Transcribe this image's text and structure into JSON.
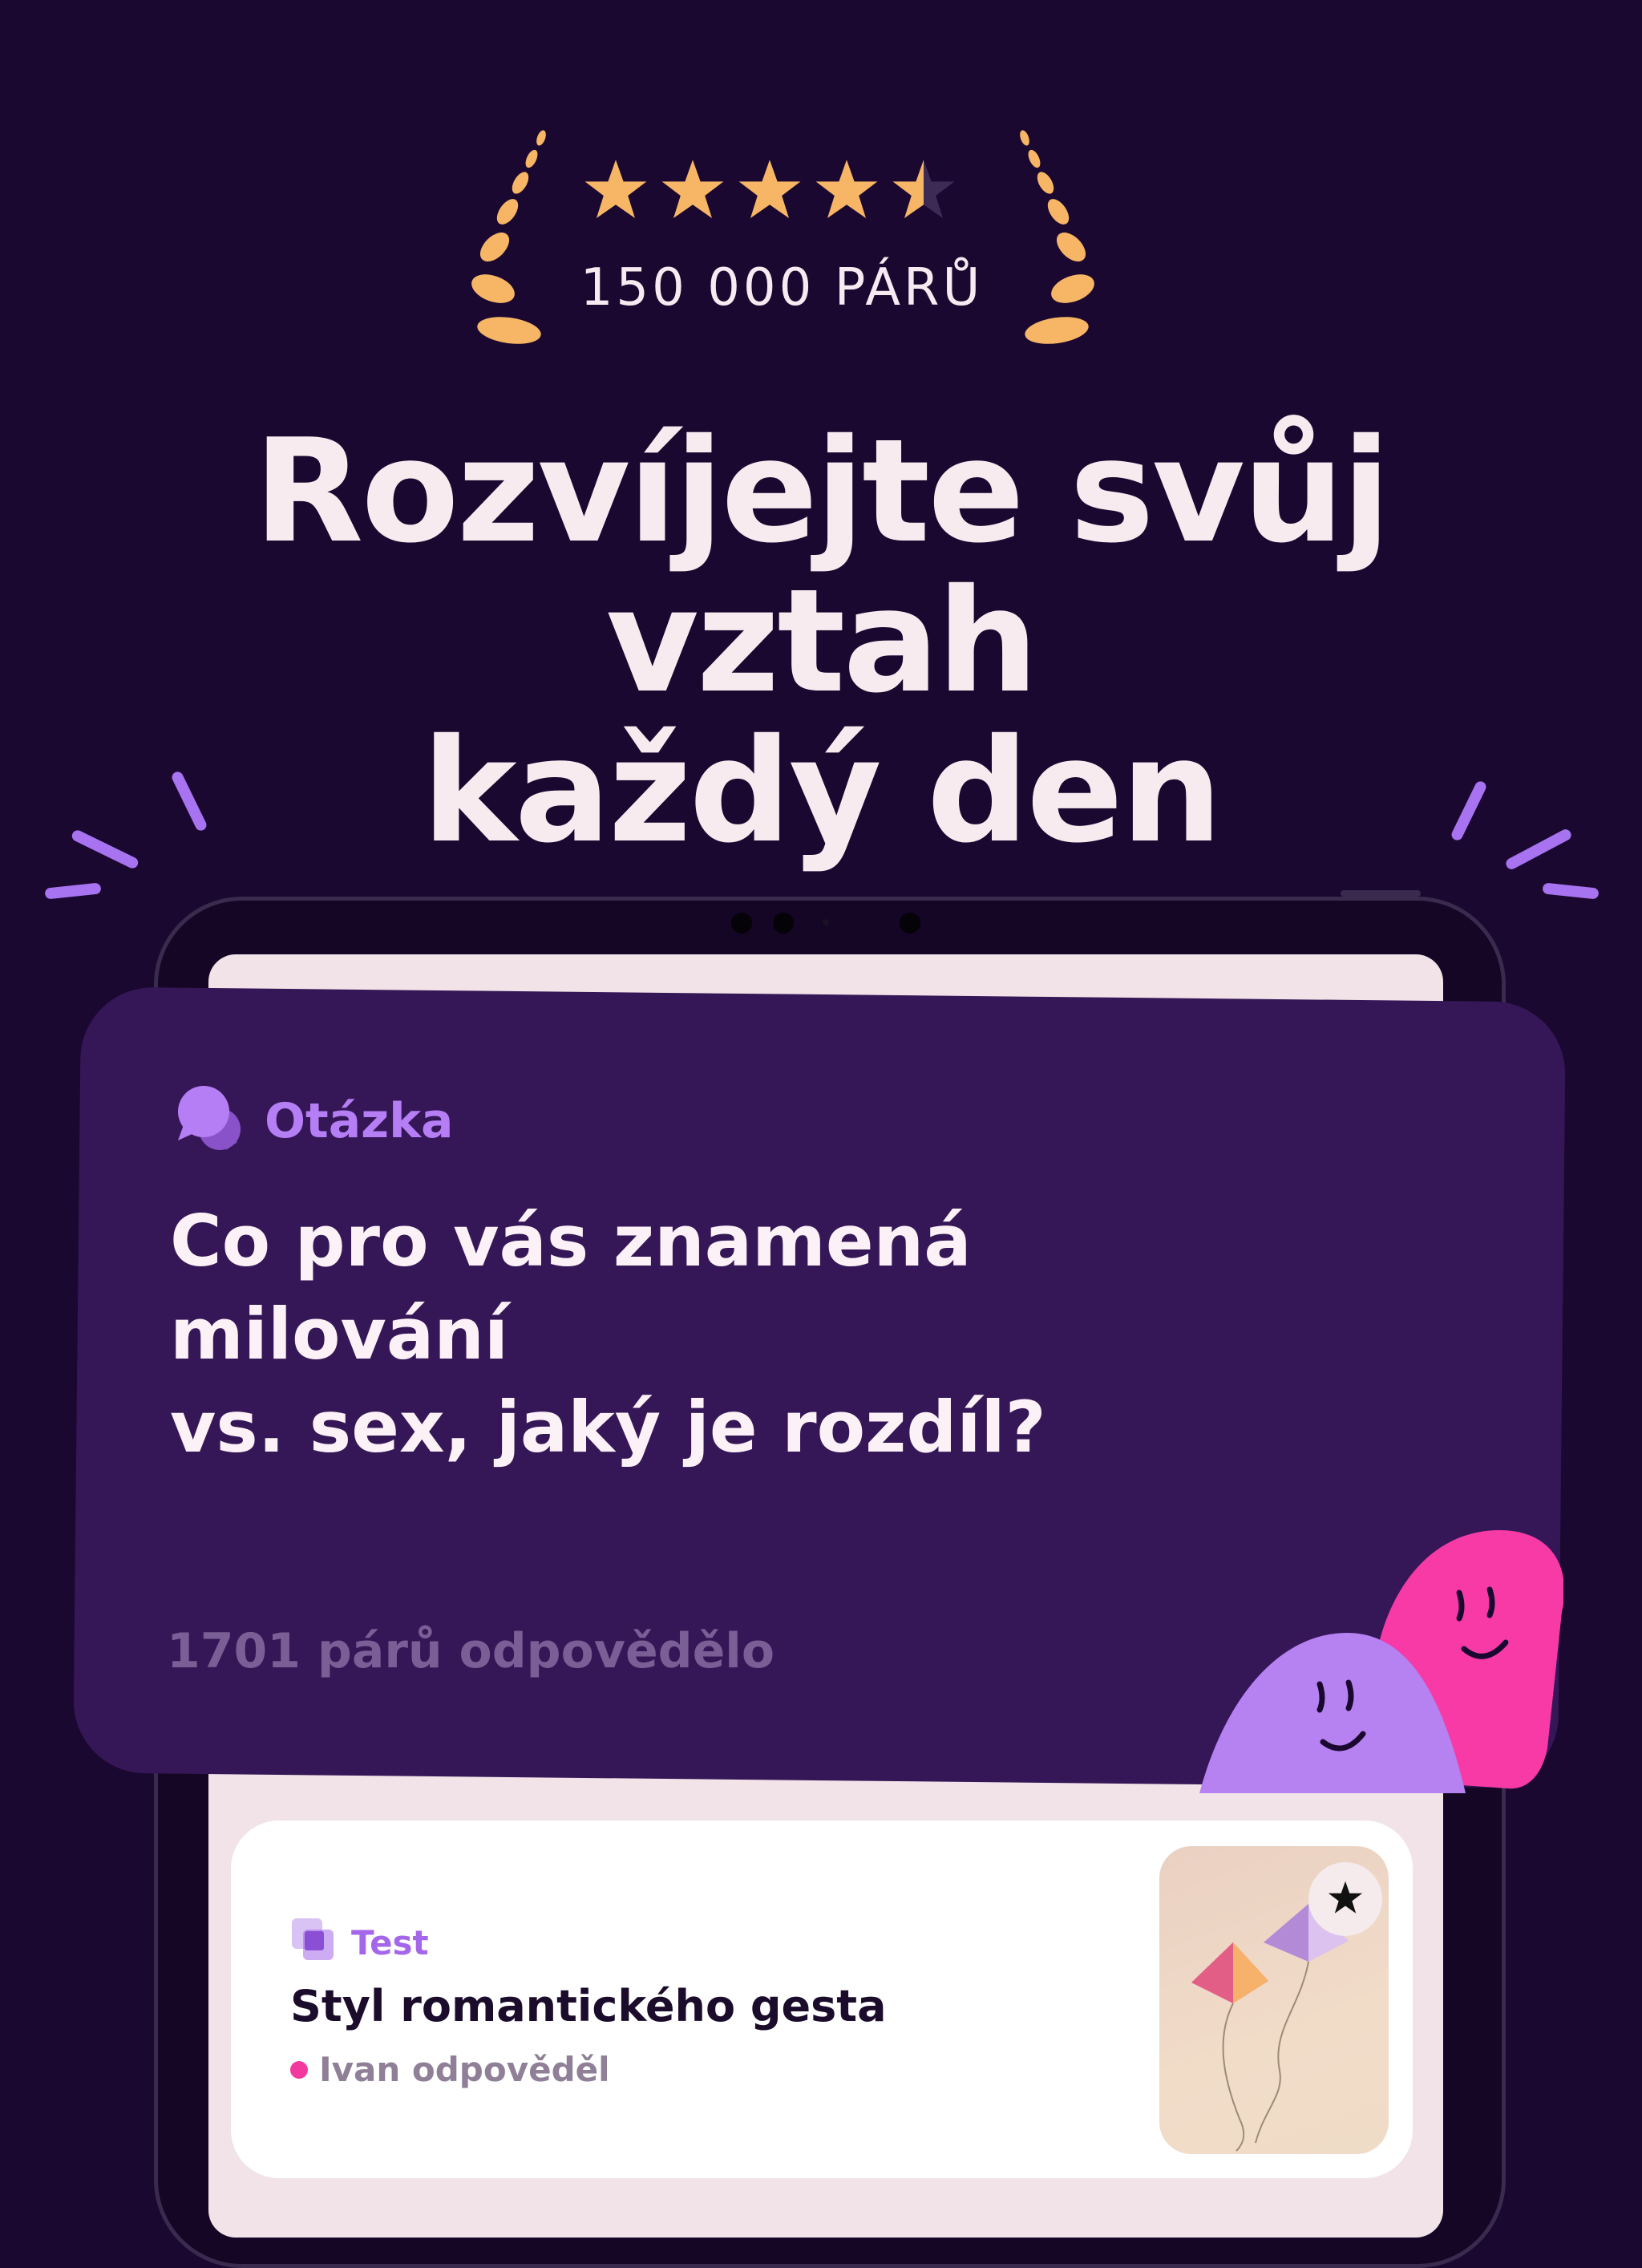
{
  "rating": {
    "stars": 4.5,
    "pairs_count": "150 000 PÁRŮ"
  },
  "headline": {
    "line1": "Rozvíjejte svůj vztah",
    "line2": "každý den"
  },
  "question_card": {
    "category": "Otázka",
    "question_line1": "Co pro vás znamená milování",
    "question_line2": "vs. sex, jaký je rozdíl?",
    "answered_count": "1701 párů odpovědělo"
  },
  "test_card": {
    "tag": "Test",
    "title": "Styl romantického gesta",
    "status": "Ivan odpověděl"
  },
  "colors": {
    "background": "#1b0830",
    "card": "#351757",
    "accent_purple": "#b57ef5",
    "accent_pink": "#f2399e",
    "star": "#f7b665",
    "laurel": "#f7b665"
  },
  "icons": [
    "laurel-icon",
    "star-icon",
    "chat-bubbles-icon",
    "test-squares-icon",
    "favorite-star-icon",
    "blob-characters"
  ]
}
